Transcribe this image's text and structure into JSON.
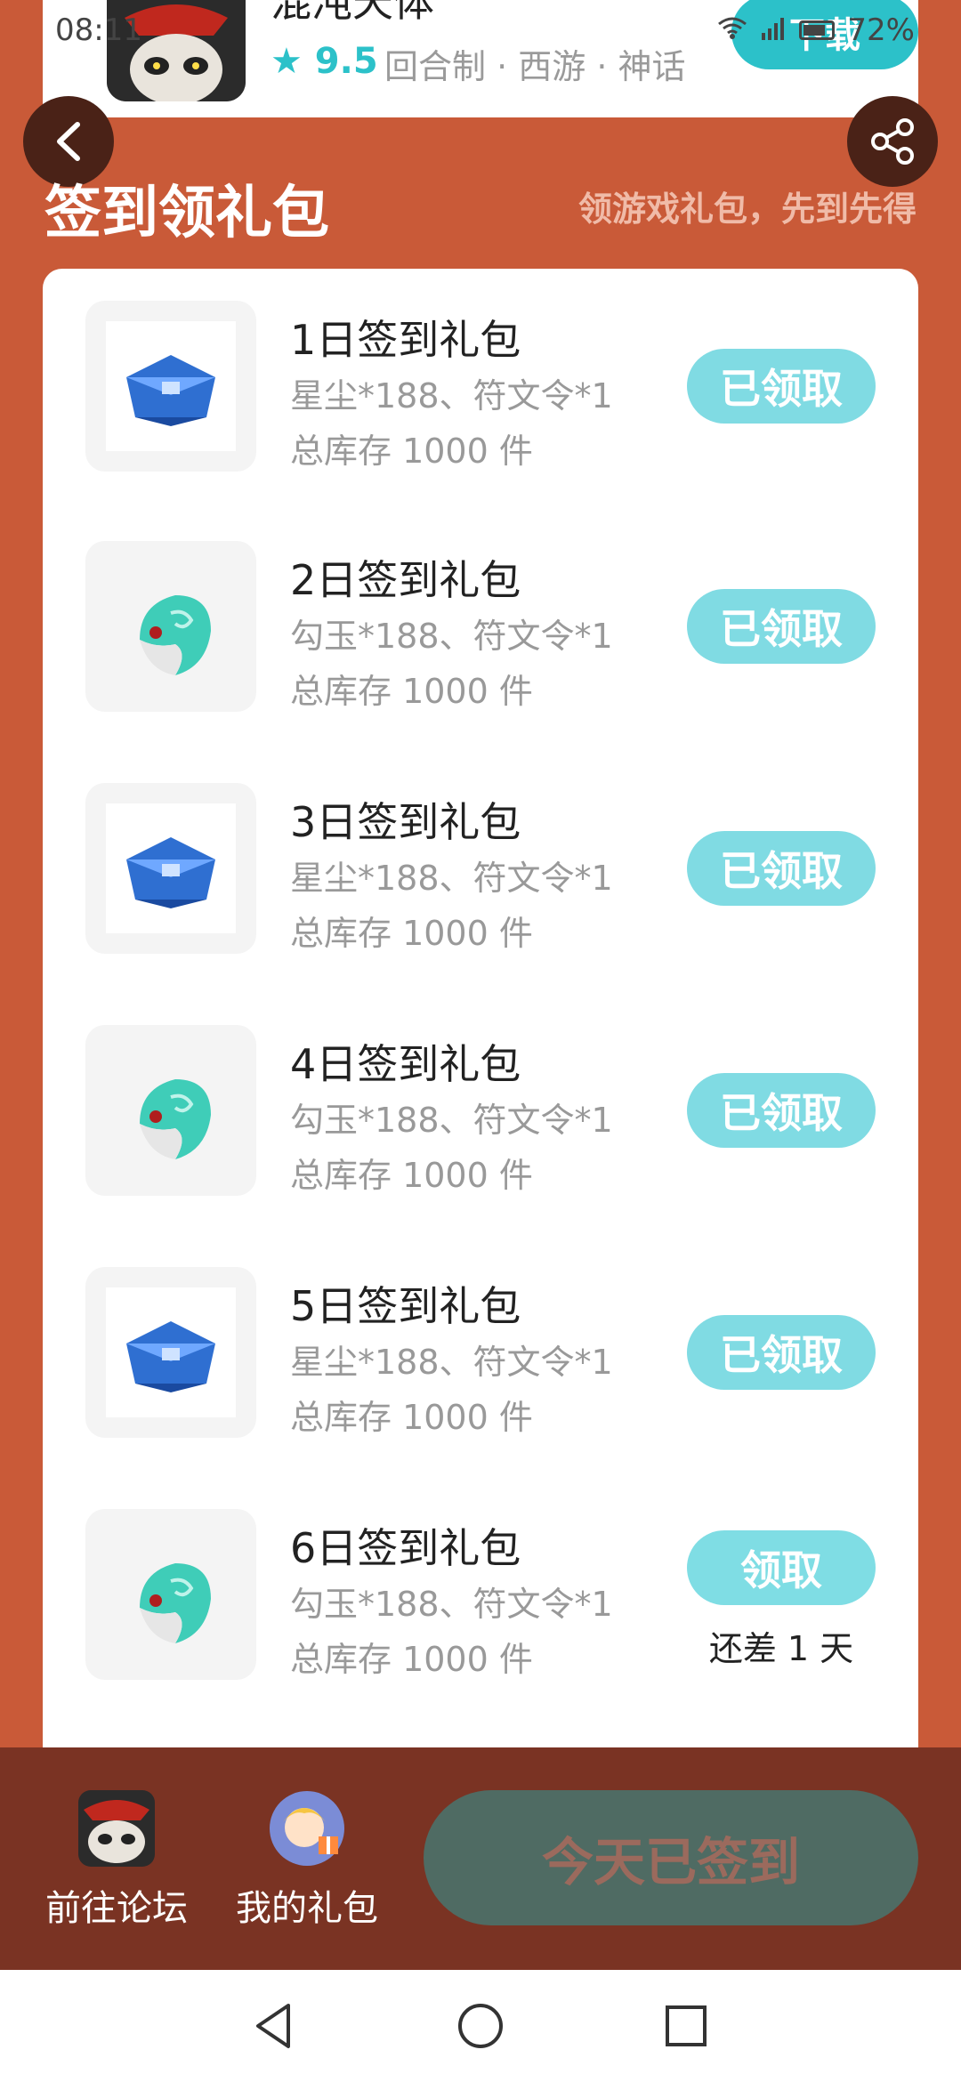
{
  "status_bar": {
    "time": "08:11",
    "battery": "72%"
  },
  "game": {
    "name": "混沌天体",
    "rating": "9.5",
    "tags": "回合制 · 西游 · 神话",
    "download_label": "下载"
  },
  "header": {
    "title": "签到领礼包",
    "subtitle": "领游戏礼包，先到先得"
  },
  "gifts": [
    {
      "name": "1日签到礼包",
      "items": "星尘*188、符文令*1",
      "stock": "总库存 1000 件",
      "button": "已领取",
      "icon": "blue-chest-icon"
    },
    {
      "name": "2日签到礼包",
      "items": "勾玉*188、符文令*1",
      "stock": "总库存 1000 件",
      "button": "已领取",
      "icon": "jade-magatama-icon"
    },
    {
      "name": "3日签到礼包",
      "items": "星尘*188、符文令*1",
      "stock": "总库存 1000 件",
      "button": "已领取",
      "icon": "blue-chest-icon"
    },
    {
      "name": "4日签到礼包",
      "items": "勾玉*188、符文令*1",
      "stock": "总库存 1000 件",
      "button": "已领取",
      "icon": "jade-magatama-icon"
    },
    {
      "name": "5日签到礼包",
      "items": "星尘*188、符文令*1",
      "stock": "总库存 1000 件",
      "button": "已领取",
      "icon": "blue-chest-icon"
    },
    {
      "name": "6日签到礼包",
      "items": "勾玉*188、符文令*1",
      "stock": "总库存 1000 件",
      "button": "领取",
      "note": "还差 1 天",
      "icon": "jade-magatama-icon"
    }
  ],
  "bottom_bar": {
    "forum_label": "前往论坛",
    "my_gifts_label": "我的礼包",
    "signed_label": "今天已签到"
  }
}
